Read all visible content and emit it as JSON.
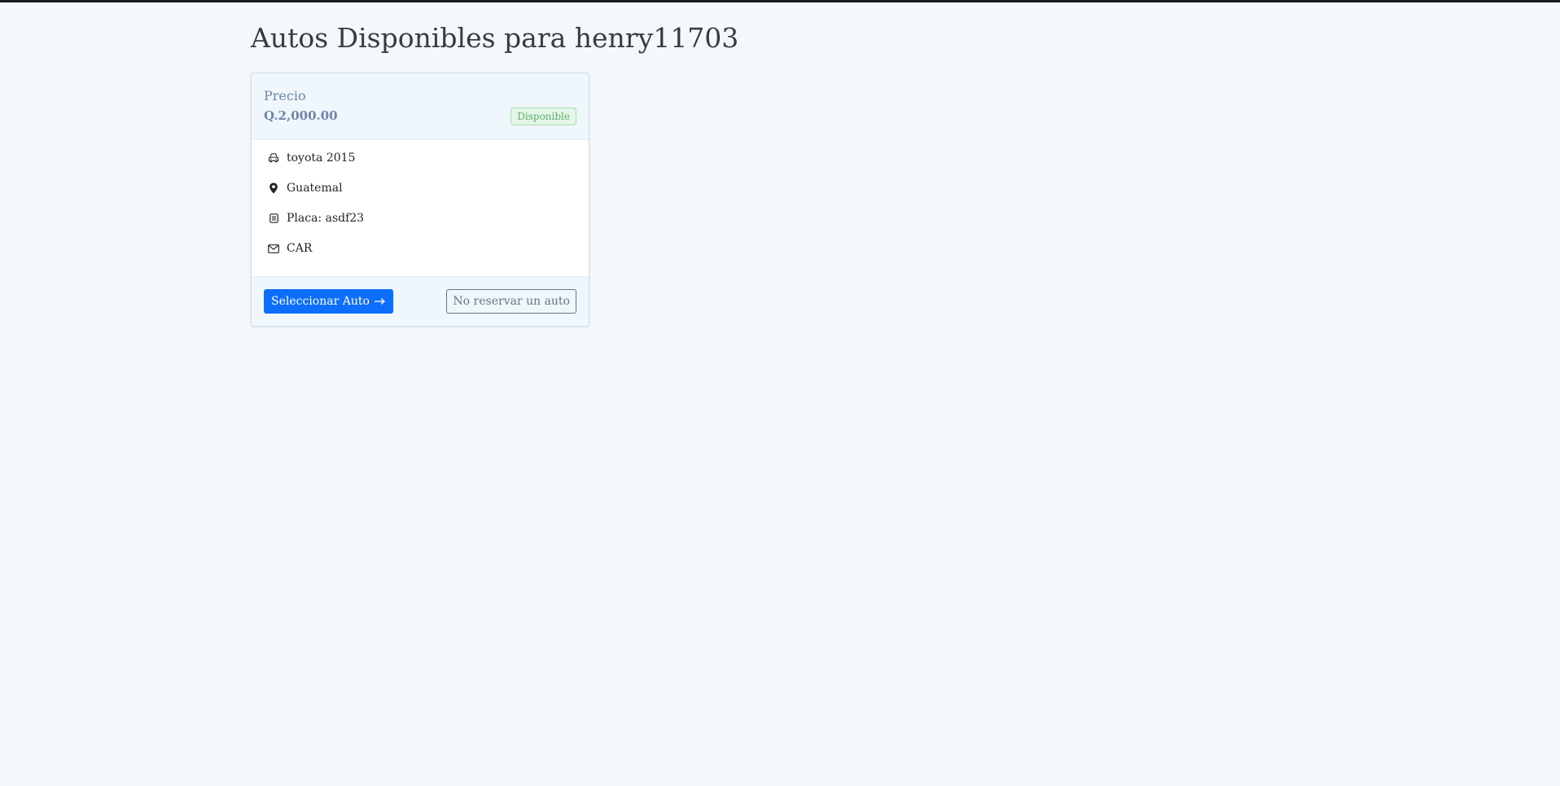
{
  "page": {
    "title": "Autos Disponibles para henry11703"
  },
  "car": {
    "price_label": "Precio",
    "price_value": "Q.2,000.00",
    "status_badge": "Disponible",
    "details": [
      {
        "icon": "car-icon",
        "text": "toyota 2015"
      },
      {
        "icon": "location-pin-icon",
        "text": "Guatemal"
      },
      {
        "icon": "plate-icon",
        "text": "Placa: asdf23"
      },
      {
        "icon": "envelope-icon",
        "text": "CAR"
      }
    ],
    "select_button": "Seleccionar Auto",
    "no_reserve_button": "No reservar un auto"
  },
  "colors": {
    "primary": "#0d6efd",
    "price_text": "#6e86a8",
    "badge_text": "#5fae72",
    "background": "#f3f8fd"
  }
}
